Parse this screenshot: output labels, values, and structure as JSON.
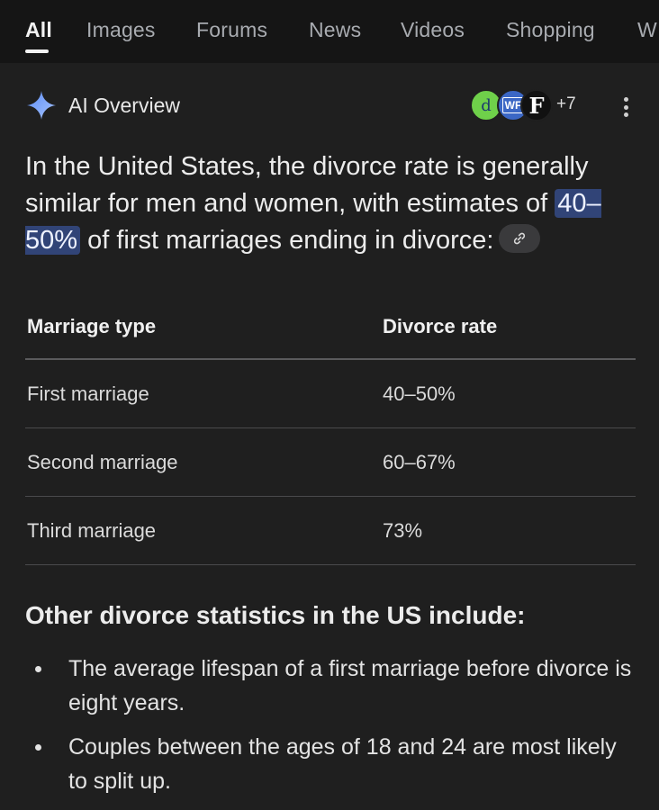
{
  "tabs": [
    {
      "label": "All",
      "active": true
    },
    {
      "label": "Images"
    },
    {
      "label": "Forums"
    },
    {
      "label": "News"
    },
    {
      "label": "Videos"
    },
    {
      "label": "Shopping"
    },
    {
      "label": "W"
    }
  ],
  "ai_overview": {
    "title": "AI Overview",
    "sources": [
      {
        "label": "d",
        "color": "#6fd04a"
      },
      {
        "label": "WF",
        "color": "#3b67c5"
      },
      {
        "label": "F",
        "color": "#111111"
      }
    ],
    "more_count": "+7",
    "summary_before": "In the United States, the divorce rate is generally similar for men and women, with estimates of ",
    "summary_highlight": "40–50%",
    "summary_after": " of first marriages ending in divorce:"
  },
  "table": {
    "headers": [
      "Marriage type",
      "Divorce rate"
    ],
    "rows": [
      [
        "First marriage",
        "40–50%"
      ],
      [
        "Second marriage",
        "60–67%"
      ],
      [
        "Third marriage",
        "73%"
      ]
    ]
  },
  "other_stats": {
    "heading": "Other divorce statistics in the US include:",
    "items": [
      "The average lifespan of a first marriage before divorce is eight years.",
      "Couples between the ages of 18 and 24 are most likely to split up."
    ]
  },
  "colors": {
    "background": "#1f1f1f",
    "tabbar": "#151515",
    "highlight": "#314477",
    "sparkle": "#8ab4f8"
  }
}
